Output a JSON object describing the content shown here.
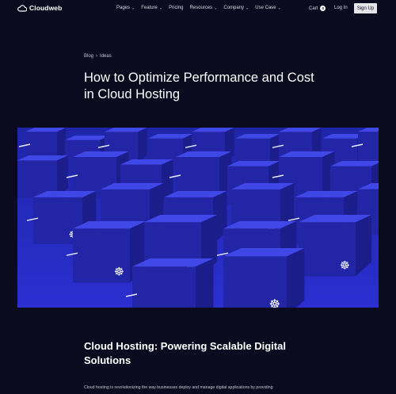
{
  "header": {
    "logo_text": "Cloudweb",
    "menu": [
      {
        "label": "Pages",
        "dropdown": true
      },
      {
        "label": "Feature",
        "dropdown": true
      },
      {
        "label": "Pricing",
        "dropdown": false
      },
      {
        "label": "Resources",
        "dropdown": true
      },
      {
        "label": "Company",
        "dropdown": true
      },
      {
        "label": "Use Case",
        "dropdown": true
      }
    ],
    "cart_label": "Cart",
    "cart_count": "0",
    "login_label": "Log In",
    "signup_label": "Sign Up"
  },
  "breadcrumb": {
    "items": [
      "Blog",
      "Ideas"
    ]
  },
  "article": {
    "title": "How to Optimize Performance and Cost in Cloud Hosting",
    "section_heading": "Cloud Hosting: Powering Scalable Digital Solutions",
    "intro_text": "Cloud hosting is revolutionizing the way businesses deploy and manage digital applications by providing"
  },
  "colors": {
    "background": "#0b0b1f",
    "hero_blue": "#2a2bb0",
    "text": "#ffffff"
  }
}
